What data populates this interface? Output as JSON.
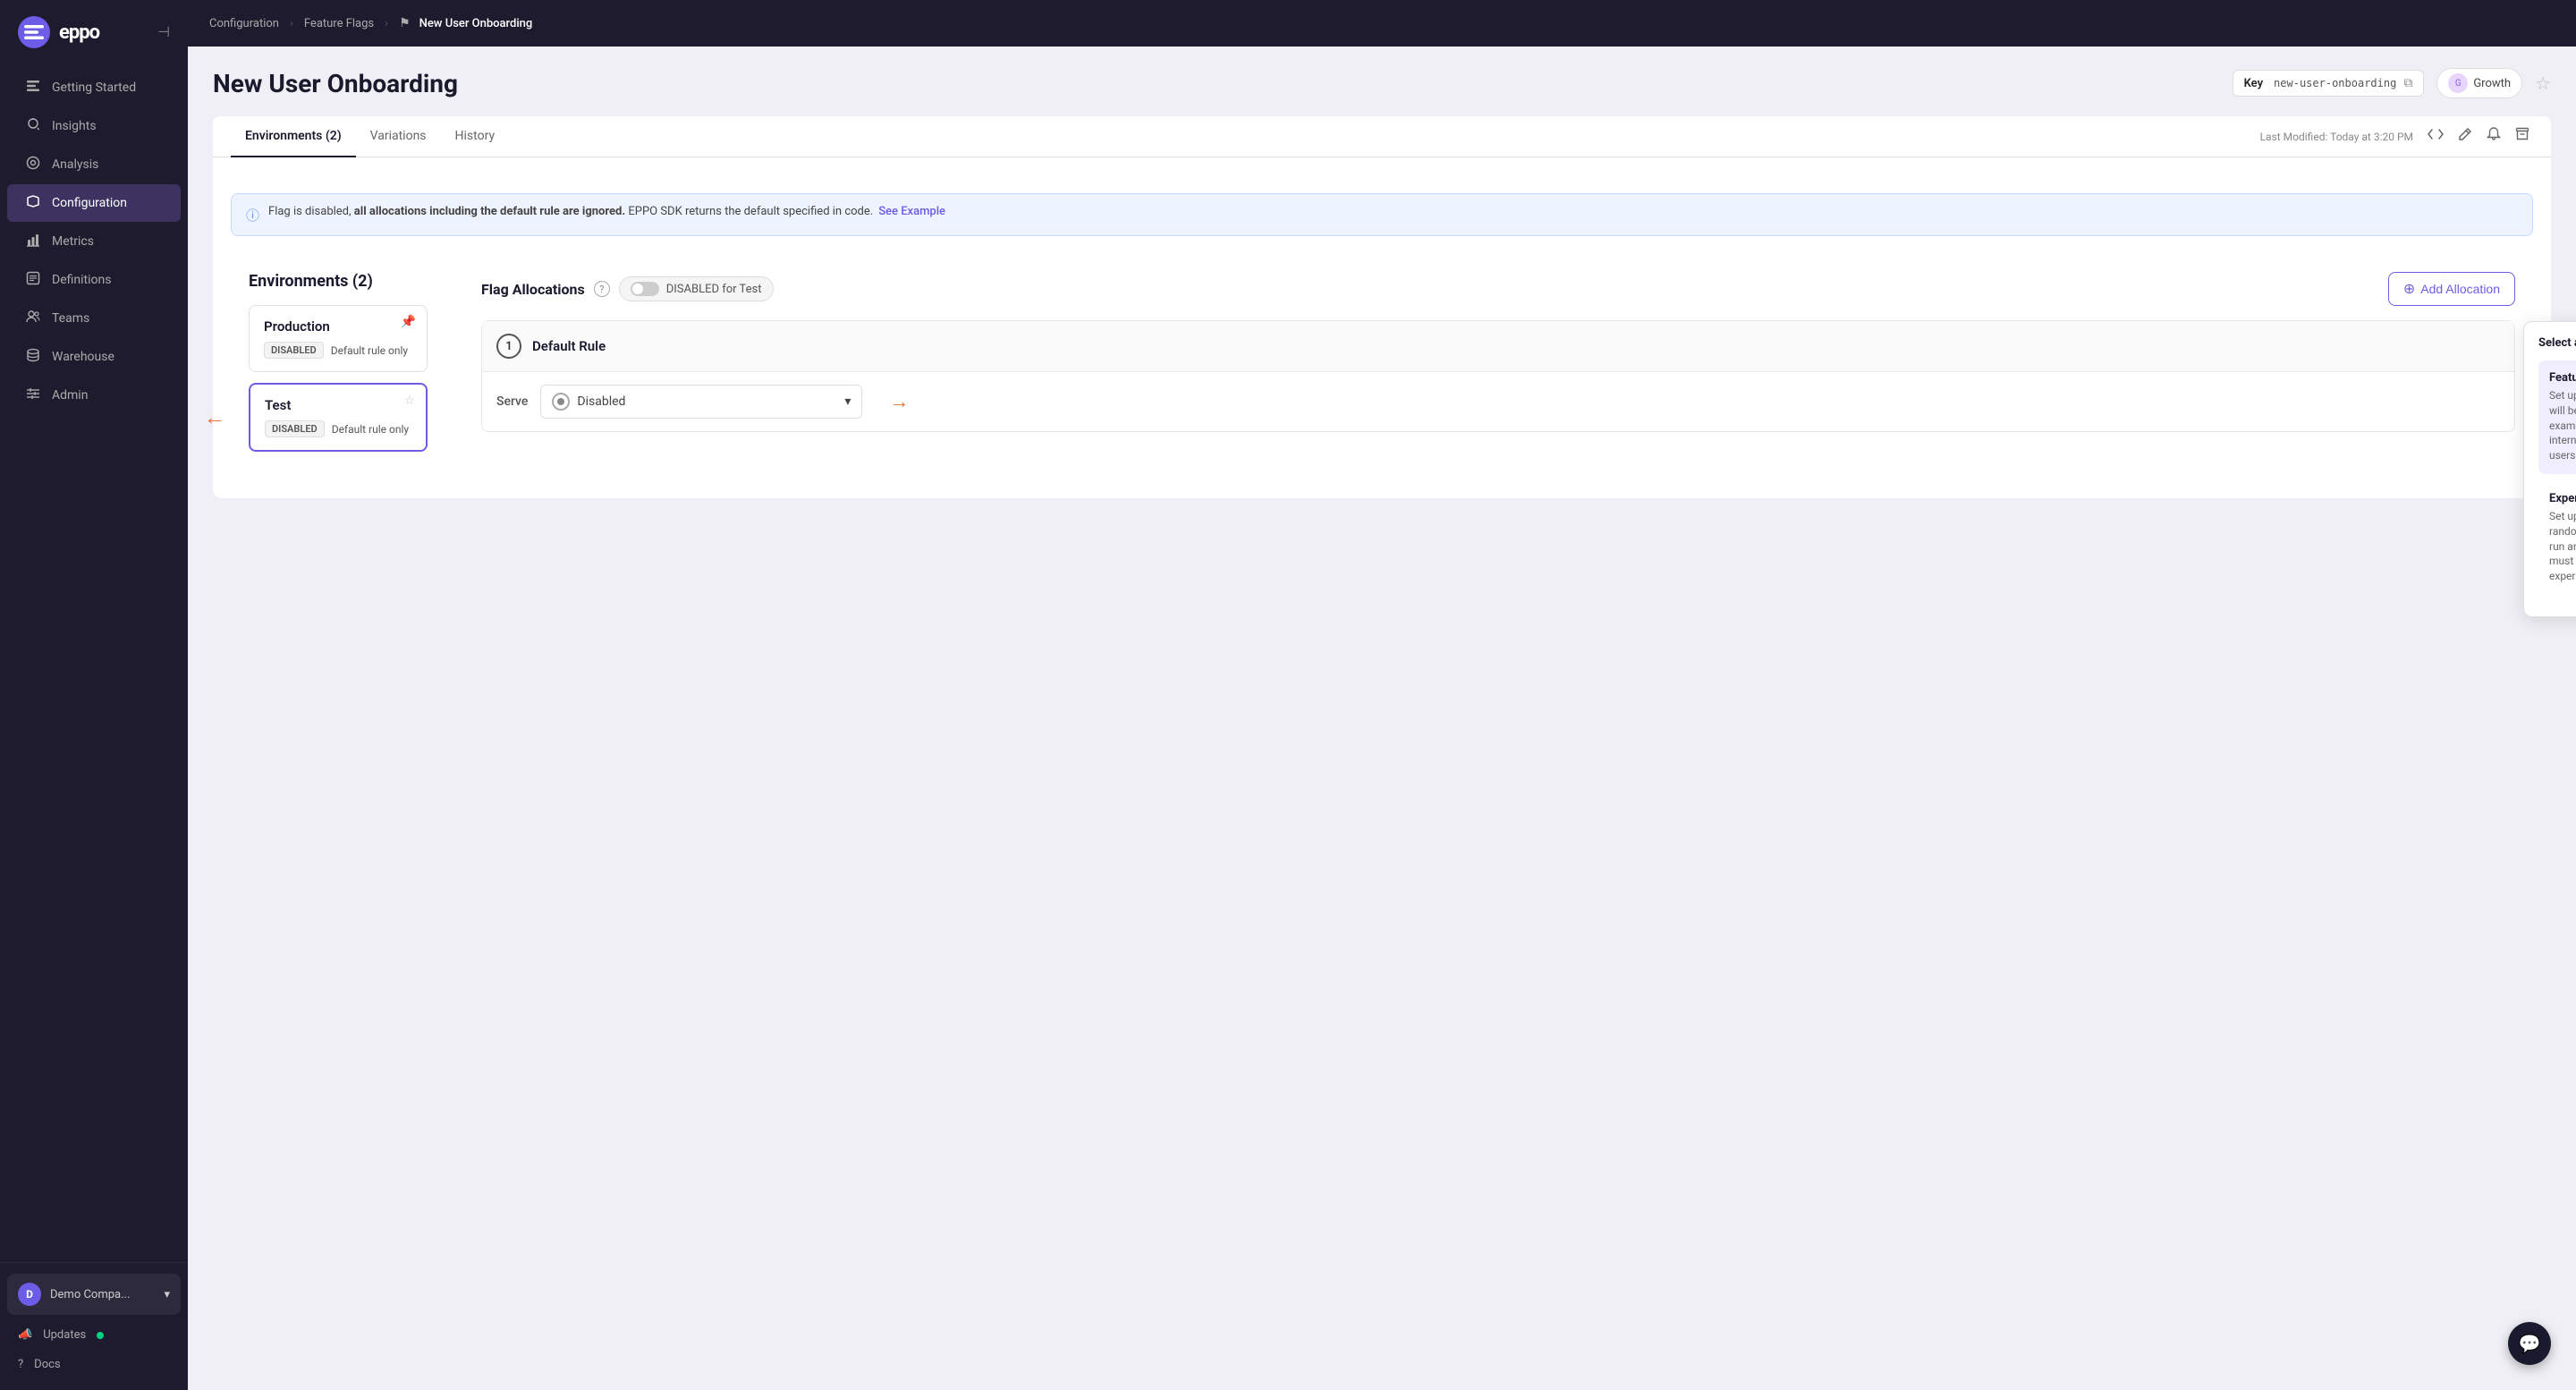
{
  "app": {
    "logo": "eppo",
    "logo_letter": "e"
  },
  "sidebar": {
    "items": [
      {
        "id": "getting-started",
        "label": "Getting Started",
        "icon": "≡"
      },
      {
        "id": "insights",
        "label": "Insights",
        "icon": "💡"
      },
      {
        "id": "analysis",
        "label": "Analysis",
        "icon": "🧪"
      },
      {
        "id": "configuration",
        "label": "Configuration",
        "icon": "⚙",
        "active": true
      },
      {
        "id": "metrics",
        "label": "Metrics",
        "icon": "×"
      },
      {
        "id": "definitions",
        "label": "Definitions",
        "icon": "□"
      },
      {
        "id": "teams",
        "label": "Teams",
        "icon": "👤"
      },
      {
        "id": "warehouse",
        "label": "Warehouse",
        "icon": "🗄"
      },
      {
        "id": "admin",
        "label": "Admin",
        "icon": "⚡"
      }
    ],
    "company": {
      "name": "Demo Compa...",
      "letter": "D"
    },
    "updates_label": "Updates",
    "docs_label": "Docs"
  },
  "topbar": {
    "breadcrumbs": [
      {
        "label": "Configuration"
      },
      {
        "label": "Feature Flags"
      },
      {
        "label": "New User Onboarding",
        "current": true
      }
    ]
  },
  "page": {
    "title": "New User Onboarding",
    "key_label": "Key",
    "key_value": "new-user-onboarding",
    "team_label": "Growth",
    "last_modified": "Last Modified: Today at 3:20 PM"
  },
  "tabs": [
    {
      "label": "Environments (2)",
      "active": true
    },
    {
      "label": "Variations"
    },
    {
      "label": "History"
    }
  ],
  "environments": {
    "title": "Environments (2)",
    "items": [
      {
        "name": "Production",
        "status": "DISABLED",
        "rule": "Default rule only",
        "pinned": true,
        "selected": false
      },
      {
        "name": "Test",
        "status": "DISABLED",
        "rule": "Default rule only",
        "pinned": false,
        "selected": true
      }
    ]
  },
  "flag_allocations": {
    "title": "Flag Allocations",
    "toggle_label": "DISABLED for Test",
    "add_button": "Add Allocation",
    "info_banner": {
      "text1": "Flag is disabled, ",
      "text2_bold": "all allocations including the default rule are ignored.",
      "text3": " EPPO SDK returns the default specified in code.",
      "see_example": "See Example"
    },
    "default_rule": {
      "number": "1",
      "title": "Default Rule",
      "serve_label": "Serve",
      "serve_value": "Disabled"
    }
  },
  "allocation_type_panel": {
    "title": "Select an Allocation type",
    "types": [
      {
        "name": "Feature Gate",
        "description": "Set up your allocation to define who will be served what variant. For example, serve a specific variant to internal users or a set of \"beta\" users.",
        "highlighted": true
      },
      {
        "name": "Experiment",
        "description": "Set up your allocation with a randomized traffic split needed to run an A/B or multi-variant test. You must select this type to run an experiment.",
        "highlighted": false
      }
    ]
  }
}
